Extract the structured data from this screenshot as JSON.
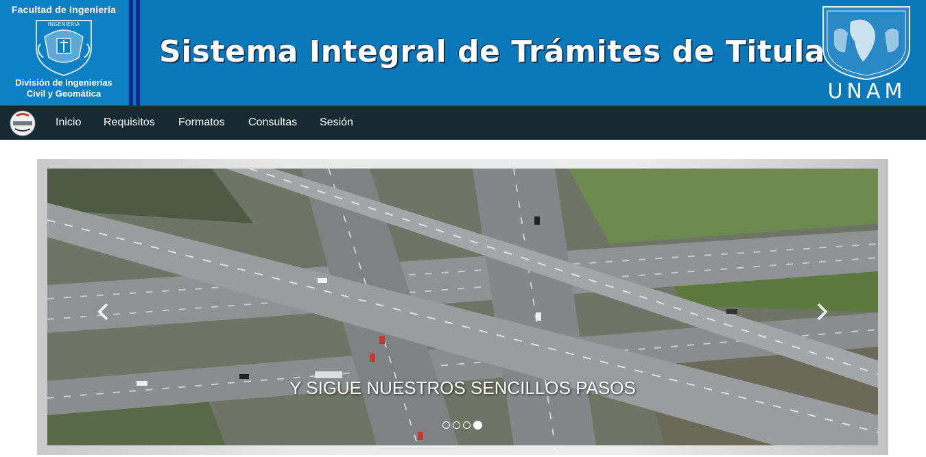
{
  "header": {
    "faculty": "Facultad de Ingeniería",
    "division_line1": "División de Ingenierías",
    "division_line2": "Civil y Geomática",
    "site_title": "Sistema Integral de Trámites de Titulación",
    "unam": "UNAM",
    "seal_text": "INGENIERIA"
  },
  "nav": {
    "logo_icon": "sitt-logo-icon",
    "items": [
      {
        "label": "Inicio"
      },
      {
        "label": "Requisitos"
      },
      {
        "label": "Formatos"
      },
      {
        "label": "Consultas"
      },
      {
        "label": "Sesión"
      }
    ]
  },
  "carousel": {
    "caption": "Y SIGUE NUESTROS SENCILLOS PASOS",
    "slide_count": 4,
    "active_slide": 4,
    "prev_icon": "chevron-left-icon",
    "next_icon": "chevron-right-icon"
  },
  "colors": {
    "banner": "#0a78b9",
    "navbar": "#182b33",
    "stripe": "#0b2a8f"
  }
}
